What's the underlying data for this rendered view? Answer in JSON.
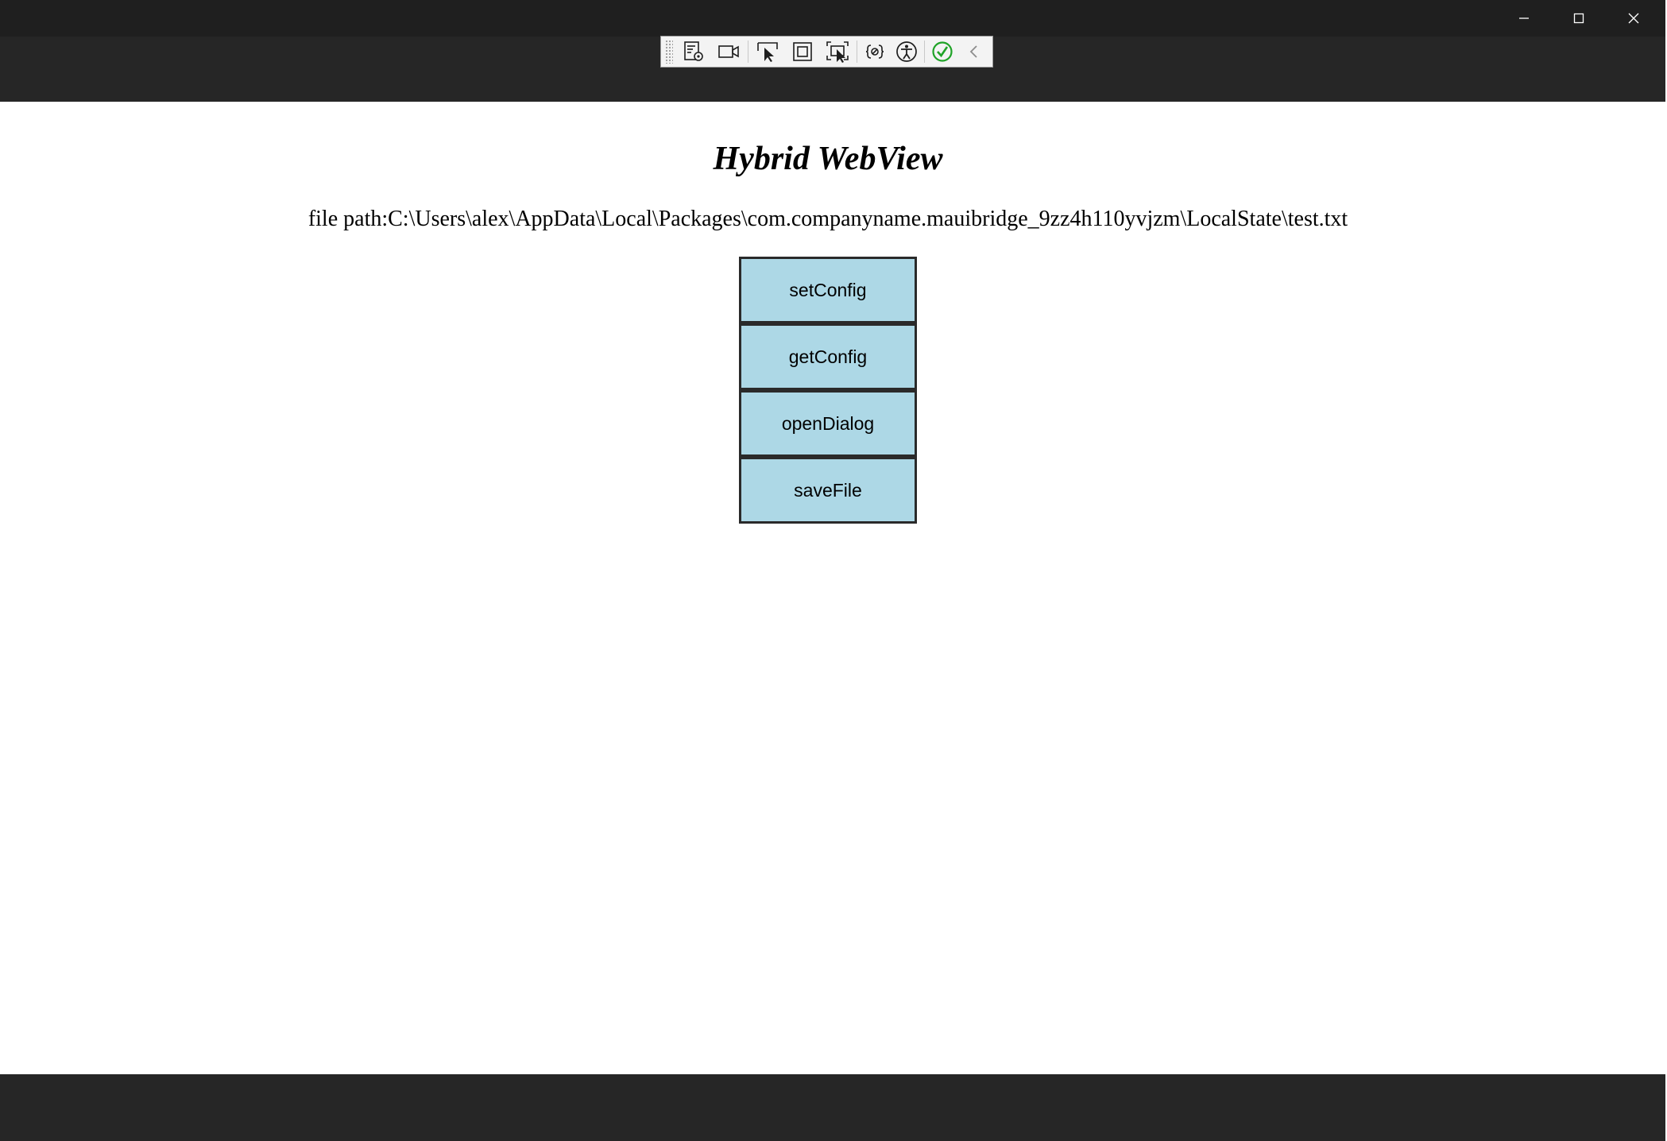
{
  "window": {
    "controls": {
      "minimize_icon": "minimize-icon",
      "maximize_icon": "maximize-icon",
      "close_icon": "close-icon"
    }
  },
  "debug_toolbar": {
    "items": [
      {
        "name": "live-visual-tree-icon"
      },
      {
        "name": "record-video-icon"
      },
      {
        "name": "select-element-icon"
      },
      {
        "name": "display-layout-adorners-icon"
      },
      {
        "name": "track-focus-icon"
      },
      {
        "name": "binding-failures-icon"
      },
      {
        "name": "accessibility-checker-icon"
      },
      {
        "name": "hot-reload-status-icon"
      },
      {
        "name": "collapse-toolbar-icon"
      }
    ]
  },
  "page": {
    "title": "Hybrid WebView",
    "file_path": "file path:C:\\Users\\alex\\AppData\\Local\\Packages\\com.companyname.mauibridge_9zz4h110yvjzm\\LocalState\\test.txt",
    "buttons": [
      {
        "label": "setConfig"
      },
      {
        "label": "getConfig"
      },
      {
        "label": "openDialog"
      },
      {
        "label": "saveFile"
      }
    ]
  },
  "colors": {
    "button_background": "#add8e6",
    "chrome_dark": "#262626",
    "status_ok": "#1fa327"
  }
}
